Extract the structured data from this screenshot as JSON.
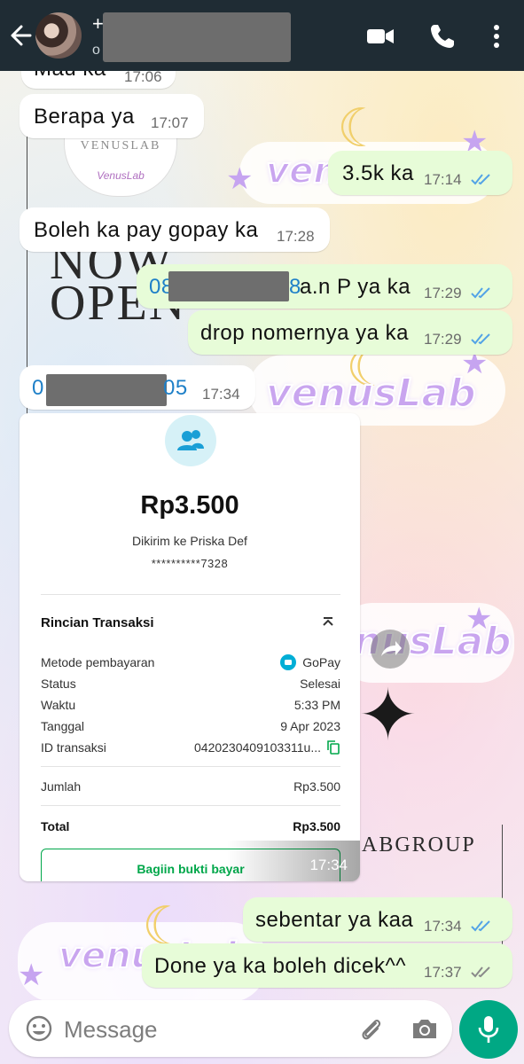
{
  "header": {
    "contact_prefix": "+",
    "contact_status": "o",
    "icons": [
      "back-arrow-icon",
      "video-call-icon",
      "voice-call-icon",
      "more-vert-icon"
    ]
  },
  "wallpaper": {
    "logo_text": "venusLab",
    "badge_text": "VENUSLAB",
    "badge_sub": "VenusLab",
    "now": "NOW",
    "open": "OPEN",
    "group": "ABGROUP"
  },
  "messages": [
    {
      "id": "m0",
      "dir": "in",
      "text": "Mau ka",
      "time": "17:06"
    },
    {
      "id": "m1",
      "dir": "in",
      "text": "Berapa ya",
      "time": "17:07"
    },
    {
      "id": "m2",
      "dir": "out",
      "text": "3.5k ka",
      "time": "17:14"
    },
    {
      "id": "m3",
      "dir": "in",
      "text": "Boleh ka pay gopay ka",
      "time": "17:28"
    },
    {
      "id": "m4",
      "dir": "out",
      "text_prefix": "08",
      "text_suffix": "8",
      "text_rest": " a.n P ya ka",
      "time": "17:29"
    },
    {
      "id": "m5",
      "dir": "out",
      "text": "drop nomernya ya ka",
      "time": "17:29"
    },
    {
      "id": "m6",
      "dir": "in",
      "text_prefix": "0",
      "text_suffix": "05",
      "time": "17:34"
    },
    {
      "id": "m8",
      "dir": "out",
      "text": "sebentar ya kaa",
      "time": "17:34"
    },
    {
      "id": "m9",
      "dir": "out",
      "text": "Done ya ka boleh dicek^^",
      "time": "17:37"
    }
  ],
  "receipt": {
    "time": "17:34",
    "amount": "Rp3.500",
    "sent_to": "Dikirim ke Priska Def",
    "account": "**********7328",
    "section_title": "Rincian Transaksi",
    "rows": [
      {
        "label": "Metode pembayaran",
        "value": "GoPay"
      },
      {
        "label": "Status",
        "value": "Selesai"
      },
      {
        "label": "Waktu",
        "value": "5:33 PM"
      },
      {
        "label": "Tanggal",
        "value": "9 Apr 2023"
      },
      {
        "label": "ID transaksi",
        "value": "0420230409103311u..."
      }
    ],
    "subtotal_label": "Jumlah",
    "subtotal_value": "Rp3.500",
    "total_label": "Total",
    "total_value": "Rp3.500",
    "button_label": "Bagiin bukti bayar"
  },
  "composer": {
    "placeholder": "Message"
  },
  "colors": {
    "header_bg": "#1f2c34",
    "incoming_bubble": "#ffffff",
    "outgoing_bubble": "#e7fcd8",
    "read_ticks": "#53a3e6",
    "sent_ticks": "#8a8a8a",
    "mic_button": "#00a884",
    "gopay_green": "#00a74a",
    "link_blue": "#1f80c8"
  }
}
